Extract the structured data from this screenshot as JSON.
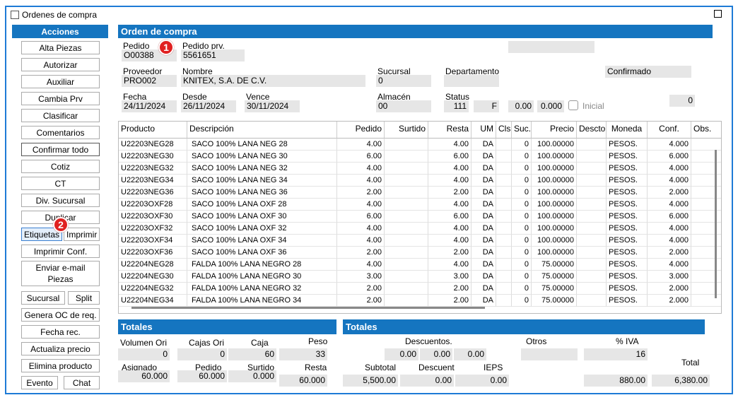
{
  "window": {
    "title": "Ordenes de compra"
  },
  "actions": {
    "header": "Acciones",
    "buttons": [
      "Alta Piezas",
      "Autorizar",
      "Auxiliar",
      "Cambia Prv",
      "Clasificar",
      "Comentarios",
      "Confirmar todo",
      "Cotiz",
      "CT",
      "Div. Sucursal",
      "Duplicar"
    ],
    "etiquetas": "Etiquetas",
    "imprimir": "Imprimir",
    "imprimir_conf": "Imprimir Conf.",
    "enviar1": "Enviar e-mail",
    "enviar2": "Piezas",
    "sucursal": "Sucursal",
    "split": "Split",
    "genera": "Genera OC de req.",
    "fecha_rec": "Fecha rec.",
    "actualiza": "Actualiza precio",
    "elimina": "Elimina producto",
    "evento": "Evento",
    "chat": "Chat"
  },
  "order": {
    "header": "Orden de compra",
    "pedido_label": "Pedido",
    "pedido": "O00388",
    "pedido_prv_label": "Pedido prv.",
    "pedido_prv": "5561651",
    "proveedor_label": "Proveedor",
    "proveedor": "PRO002",
    "nombre_label": "Nombre",
    "nombre": "KNITEX, S.A. DE C.V.",
    "sucursal_label": "Sucursal",
    "sucursal": "0",
    "departamento_label": "Departamento",
    "confirmado": "Confirmado",
    "fecha_label": "Fecha",
    "fecha": "24/11/2024",
    "desde_label": "Desde",
    "desde": "26/11/2024",
    "vence_label": "Vence",
    "vence": "30/11/2024",
    "almacen_label": "Almacén",
    "almacen": "00",
    "status_label": "Status",
    "status": "111",
    "status_f": "F",
    "v1": "0.00",
    "v2": "0.000",
    "inicial": "Inicial",
    "extra": "0"
  },
  "badges": {
    "b1": "1",
    "b2": "2"
  },
  "table": {
    "headers": [
      "Producto",
      "Descripción",
      "Pedido",
      "Surtido",
      "Resta",
      "UM",
      "Cls",
      "Suc.",
      "Precio",
      "Descto",
      "Moneda",
      "Conf.",
      "Obs."
    ],
    "rows": [
      [
        "U22203NEG28",
        "SACO 100% LANA NEG 28",
        "4.00",
        "",
        "4.00",
        "DA",
        "",
        "0",
        "100.00000",
        "",
        "PESOS.",
        "4.000",
        ""
      ],
      [
        "U22203NEG30",
        "SACO 100% LANA NEG 30",
        "6.00",
        "",
        "6.00",
        "DA",
        "",
        "0",
        "100.00000",
        "",
        "PESOS.",
        "6.000",
        ""
      ],
      [
        "U22203NEG32",
        "SACO 100% LANA NEG 32",
        "4.00",
        "",
        "4.00",
        "DA",
        "",
        "0",
        "100.00000",
        "",
        "PESOS.",
        "4.000",
        ""
      ],
      [
        "U22203NEG34",
        "SACO 100% LANA NEG 34",
        "4.00",
        "",
        "4.00",
        "DA",
        "",
        "0",
        "100.00000",
        "",
        "PESOS.",
        "4.000",
        ""
      ],
      [
        "U22203NEG36",
        "SACO 100% LANA NEG 36",
        "2.00",
        "",
        "2.00",
        "DA",
        "",
        "0",
        "100.00000",
        "",
        "PESOS.",
        "2.000",
        ""
      ],
      [
        "U22203OXF28",
        "SACO 100% LANA OXF 28",
        "4.00",
        "",
        "4.00",
        "DA",
        "",
        "0",
        "100.00000",
        "",
        "PESOS.",
        "4.000",
        ""
      ],
      [
        "U22203OXF30",
        "SACO 100% LANA OXF 30",
        "6.00",
        "",
        "6.00",
        "DA",
        "",
        "0",
        "100.00000",
        "",
        "PESOS.",
        "6.000",
        ""
      ],
      [
        "U22203OXF32",
        "SACO 100% LANA OXF 32",
        "4.00",
        "",
        "4.00",
        "DA",
        "",
        "0",
        "100.00000",
        "",
        "PESOS.",
        "4.000",
        ""
      ],
      [
        "U22203OXF34",
        "SACO 100% LANA OXF 34",
        "4.00",
        "",
        "4.00",
        "DA",
        "",
        "0",
        "100.00000",
        "",
        "PESOS.",
        "4.000",
        ""
      ],
      [
        "U22203OXF36",
        "SACO 100% LANA OXF 36",
        "2.00",
        "",
        "2.00",
        "DA",
        "",
        "0",
        "100.00000",
        "",
        "PESOS.",
        "2.000",
        ""
      ],
      [
        "U22204NEG28",
        "FALDA 100% LANA NEGRO 28",
        "4.00",
        "",
        "4.00",
        "DA",
        "",
        "0",
        "75.00000",
        "",
        "PESOS.",
        "4.000",
        ""
      ],
      [
        "U22204NEG30",
        "FALDA 100% LANA NEGRO 30",
        "3.00",
        "",
        "3.00",
        "DA",
        "",
        "0",
        "75.00000",
        "",
        "PESOS.",
        "3.000",
        ""
      ],
      [
        "U22204NEG32",
        "FALDA 100% LANA NEGRO 32",
        "2.00",
        "",
        "2.00",
        "DA",
        "",
        "0",
        "75.00000",
        "",
        "PESOS.",
        "2.000",
        ""
      ],
      [
        "U22204NEG34",
        "FALDA 100% LANA NEGRO 34",
        "2.00",
        "",
        "2.00",
        "DA",
        "",
        "0",
        "75.00000",
        "",
        "PESOS.",
        "2.000",
        ""
      ]
    ]
  },
  "totales1": {
    "header": "Totales",
    "volumen_label": "Volumen Ori",
    "volumen": "0",
    "cajas_label": "Cajas Ori",
    "cajas": "0",
    "caja_label": "Caja",
    "caja": "60",
    "peso_label": "Peso",
    "peso": "33",
    "asignado_label": "Asignado",
    "asignado": "60.000",
    "pedido_label": "Pedido",
    "pedido": "60.000",
    "surtido_label": "Surtido",
    "surtido": "0.000",
    "resta_label": "Resta",
    "resta": "60.000"
  },
  "totales2": {
    "header": "Totales",
    "descuentos_label": "Descuentos.",
    "d1": "0.00",
    "d2": "0.00",
    "d3": "0.00",
    "otros_label": "Otros",
    "iva_label": "% IVA",
    "iva": "16",
    "subtotal_label": "Subtotal",
    "subtotal": "5,500.00",
    "descuent_label": "Descuent",
    "descuent": "0.00",
    "ieps_label": "IEPS",
    "ieps": "0.00",
    "iva_amount": "880.00",
    "total_label": "Total",
    "total": "6,380.00"
  }
}
